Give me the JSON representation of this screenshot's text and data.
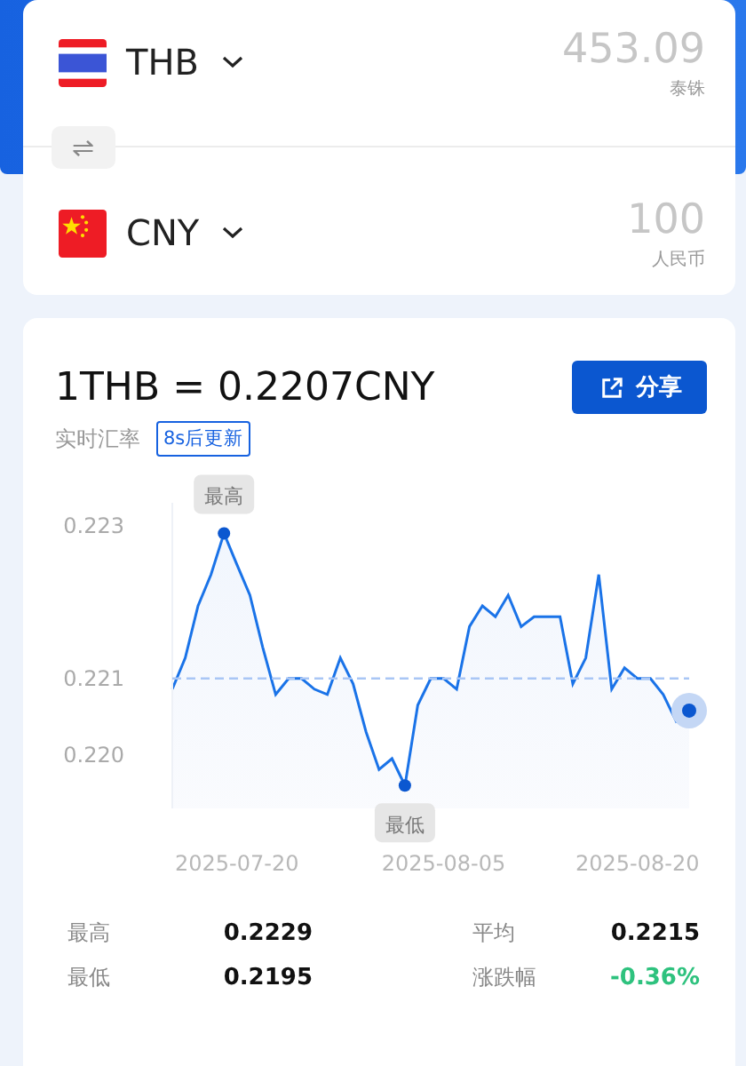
{
  "converter": {
    "from": {
      "kind": "thailand",
      "code": "THB",
      "amount": "453.09",
      "name": "泰铢"
    },
    "swap_icon": "⇌",
    "to": {
      "kind": "china",
      "code": "CNY",
      "amount": "100",
      "name": "人民币"
    }
  },
  "rate": {
    "title": "1THB = 0.2207CNY",
    "share_button": "分享",
    "subtitle": "实时汇率",
    "refresh_badge": "8s后更新",
    "chart_data": {
      "type": "area",
      "categories": [
        null,
        null,
        null,
        null,
        null,
        "2025-07-20",
        null,
        null,
        null,
        null,
        null,
        null,
        null,
        null,
        null,
        null,
        null,
        null,
        null,
        null,
        null,
        "2025-08-05",
        null,
        null,
        null,
        null,
        null,
        null,
        null,
        null,
        null,
        null,
        null,
        null,
        null,
        null,
        "2025-08-20",
        null,
        null,
        null,
        null
      ],
      "series": [
        {
          "color": "#1a73e8",
          "values": [
            0.22086,
            0.22127,
            0.22195,
            0.22236,
            0.2229,
            0.22249,
            0.22209,
            0.22141,
            0.22079,
            0.221,
            0.221,
            0.22086,
            0.22079,
            0.22127,
            0.22093,
            0.2203,
            0.21981,
            0.21995,
            0.2196,
            0.22065,
            0.221,
            0.221,
            0.22086,
            0.22168,
            0.22195,
            0.22181,
            0.22209,
            0.22168,
            0.22181,
            0.22181,
            0.22181,
            0.22093,
            0.22127,
            0.22236,
            0.22086,
            0.22114,
            0.221,
            0.221,
            0.22079,
            0.22044,
            0.22058
          ]
        }
      ],
      "ylim": [
        0.2193,
        0.2233
      ],
      "yticks": [
        {
          "value": 0.223,
          "label": "0.223"
        },
        {
          "value": 0.221,
          "label": "0.221"
        },
        {
          "value": 0.22,
          "label": "0.220"
        }
      ],
      "ref_lines": [
        {
          "axis": "y",
          "value": 0.221
        }
      ],
      "annotations": [
        {
          "text": "最高"
        },
        {
          "text": "最低"
        }
      ]
    }
  },
  "stats": [
    {
      "label": "最高",
      "value": "0.2229",
      "color": "#111111"
    },
    {
      "label": "平均",
      "value": "0.2215",
      "color": "#111111"
    },
    {
      "label": "最低",
      "value": "0.2195",
      "color": "#111111"
    },
    {
      "label": "涨跌幅",
      "value": "-0.36%",
      "color": "#2ec27e"
    }
  ]
}
